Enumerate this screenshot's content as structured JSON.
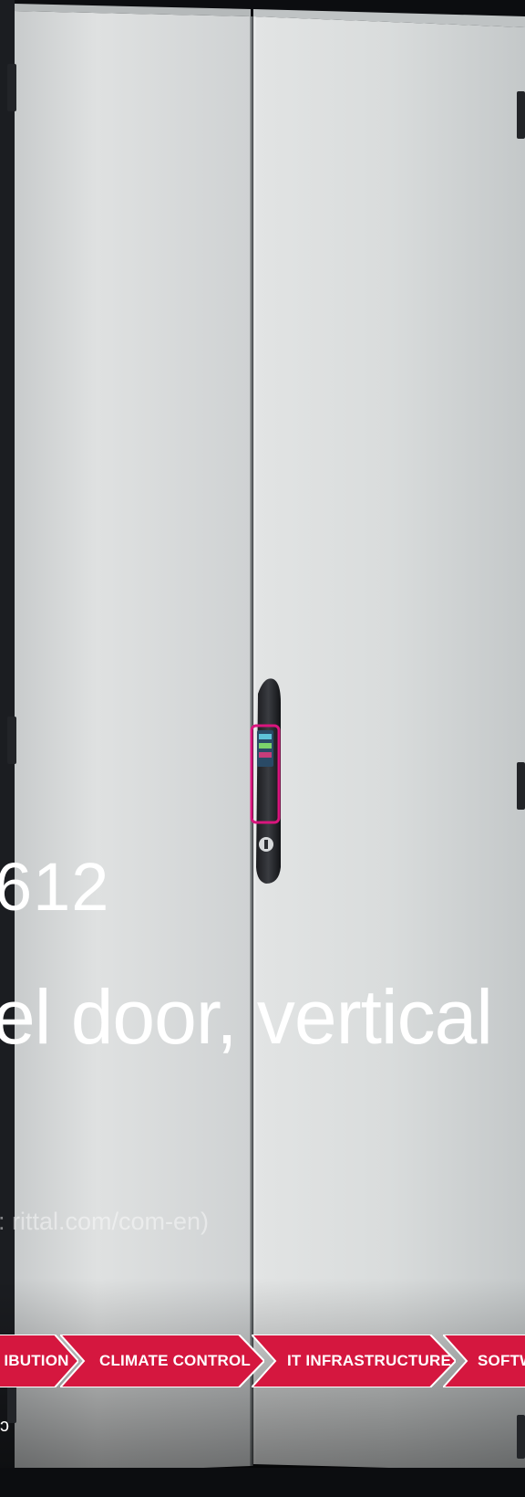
{
  "product": {
    "part_number": "612",
    "title": "el door, vertical",
    "source": ": rittal.com/com-en)"
  },
  "nav": {
    "items": [
      {
        "label": "IBUTION"
      },
      {
        "label": "CLIMATE CONTROL"
      },
      {
        "label": "IT INFRASTRUCTURE"
      },
      {
        "label": "SOFTW"
      }
    ]
  },
  "footer": {
    "mark": "ɔ"
  },
  "colors": {
    "accent": "#d5173f",
    "door": "#d9dbdb",
    "background": "#0c0d10",
    "handle_trim": "#d9157d"
  }
}
